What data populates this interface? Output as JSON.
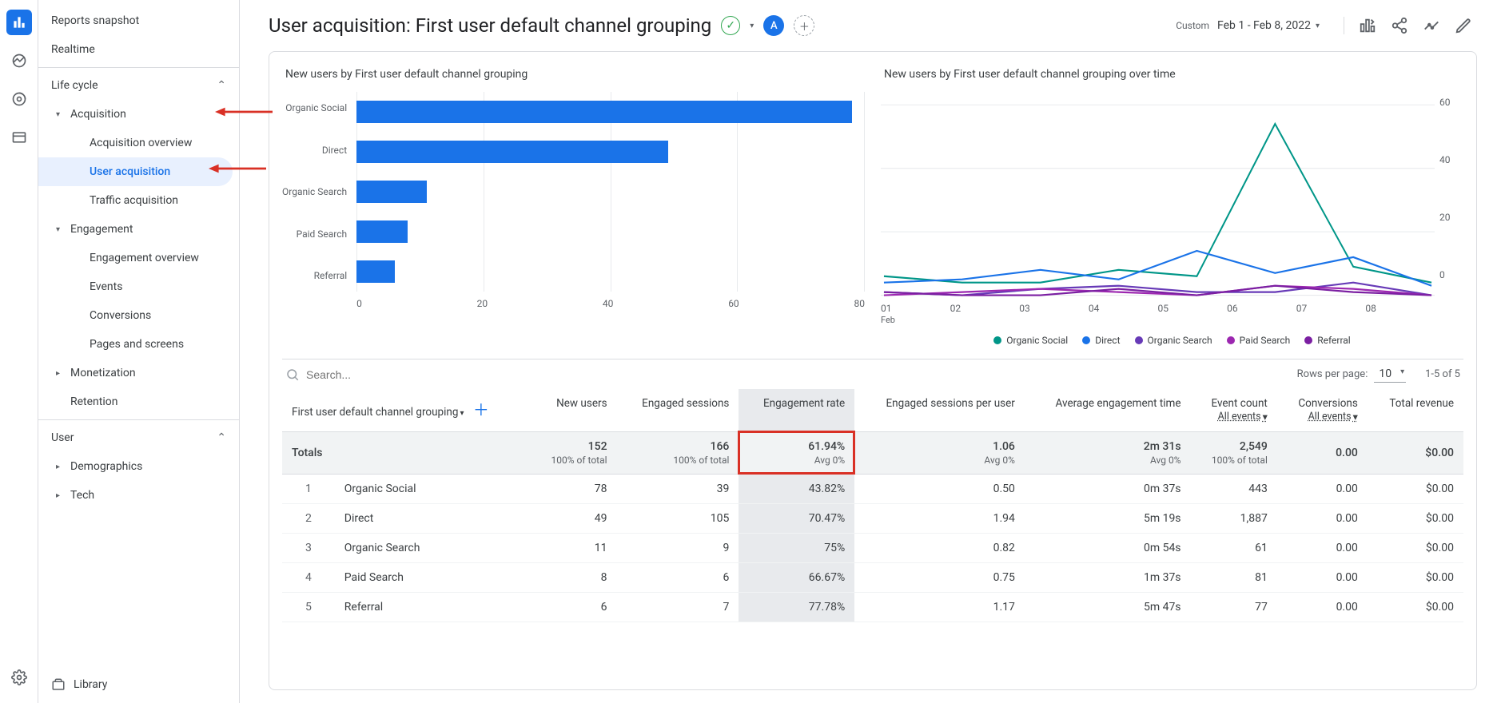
{
  "iconbar": {
    "items": [
      "reports",
      "realtime",
      "explore",
      "advertising"
    ],
    "bottom": "settings"
  },
  "sidebar": {
    "top": [
      "Reports snapshot",
      "Realtime"
    ],
    "lifecycle_label": "Life cycle",
    "acquisition": {
      "label": "Acquisition",
      "items": [
        "Acquisition overview",
        "User acquisition",
        "Traffic acquisition"
      ],
      "active_index": 1
    },
    "engagement": {
      "label": "Engagement",
      "items": [
        "Engagement overview",
        "Events",
        "Conversions",
        "Pages and screens"
      ]
    },
    "monetization": {
      "label": "Monetization"
    },
    "retention": {
      "label": "Retention"
    },
    "user_label": "User",
    "demographics": {
      "label": "Demographics"
    },
    "tech": {
      "label": "Tech"
    },
    "library": "Library"
  },
  "header": {
    "title": "User acquisition: First user default channel grouping",
    "avatar": "A",
    "custom_label": "Custom",
    "daterange": "Feb 1 - Feb 8, 2022"
  },
  "chart_data": [
    {
      "type": "bar",
      "title": "New users by First user default channel grouping",
      "categories": [
        "Organic Social",
        "Direct",
        "Organic Search",
        "Paid Search",
        "Referral"
      ],
      "values": [
        78,
        49,
        11,
        8,
        6
      ],
      "xlabel": "",
      "ylabel": "",
      "xlim": [
        0,
        80
      ],
      "xticks": [
        0,
        20,
        40,
        60,
        80
      ]
    },
    {
      "type": "line",
      "title": "New users by First user default channel grouping over time",
      "x": [
        "01",
        "02",
        "03",
        "04",
        "05",
        "06",
        "07",
        "08"
      ],
      "x_sublabel": "Feb",
      "ylim": [
        0,
        60
      ],
      "yticks": [
        0,
        20,
        40,
        60
      ],
      "series": [
        {
          "name": "Organic Social",
          "color": "#009688",
          "values": [
            6,
            4,
            4,
            8,
            6,
            54,
            9,
            4
          ]
        },
        {
          "name": "Direct",
          "color": "#1a73e8",
          "values": [
            4,
            5,
            8,
            5,
            14,
            7,
            12,
            3
          ]
        },
        {
          "name": "Organic Search",
          "color": "#673ab7",
          "values": [
            1,
            0,
            2,
            3,
            1,
            1,
            4,
            0
          ]
        },
        {
          "name": "Paid Search",
          "color": "#9c27b0",
          "values": [
            0,
            1,
            2,
            1,
            0,
            3,
            2,
            0
          ]
        },
        {
          "name": "Referral",
          "color": "#7b1fa2",
          "values": [
            1,
            0,
            0,
            2,
            0,
            3,
            1,
            0
          ]
        }
      ]
    }
  ],
  "table": {
    "search_placeholder": "Search...",
    "rows_per_page_label": "Rows per page:",
    "rows_per_page_value": "10",
    "pager": "1-5 of 5",
    "columns": {
      "c0": "First user default channel grouping",
      "c1": "New users",
      "c2": "Engaged sessions",
      "c3": "Engagement rate",
      "c4": "Engaged sessions per user",
      "c5": "Average engagement time",
      "c6": "Event count",
      "c6_sub": "All events",
      "c7": "Conversions",
      "c7_sub": "All events",
      "c8": "Total revenue"
    },
    "totals": {
      "label": "Totals",
      "new_users": "152",
      "new_users_sub": "100% of total",
      "engaged_sessions": "166",
      "engaged_sessions_sub": "100% of total",
      "engagement_rate": "61.94%",
      "engagement_rate_sub": "Avg 0%",
      "sessions_per_user": "1.06",
      "sessions_per_user_sub": "Avg 0%",
      "avg_time": "2m 31s",
      "avg_time_sub": "Avg 0%",
      "event_count": "2,549",
      "event_count_sub": "100% of total",
      "conversions": "0.00",
      "revenue": "$0.00"
    },
    "rows": [
      {
        "idx": "1",
        "name": "Organic Social",
        "new_users": "78",
        "engaged": "39",
        "rate": "43.82%",
        "spu": "0.50",
        "time": "0m 37s",
        "events": "443",
        "conv": "0.00",
        "rev": "$0.00"
      },
      {
        "idx": "2",
        "name": "Direct",
        "new_users": "49",
        "engaged": "105",
        "rate": "70.47%",
        "spu": "1.94",
        "time": "5m 19s",
        "events": "1,887",
        "conv": "0.00",
        "rev": "$0.00"
      },
      {
        "idx": "3",
        "name": "Organic Search",
        "new_users": "11",
        "engaged": "9",
        "rate": "75%",
        "spu": "0.82",
        "time": "0m 54s",
        "events": "61",
        "conv": "0.00",
        "rev": "$0.00"
      },
      {
        "idx": "4",
        "name": "Paid Search",
        "new_users": "8",
        "engaged": "6",
        "rate": "66.67%",
        "spu": "0.75",
        "time": "1m 37s",
        "events": "81",
        "conv": "0.00",
        "rev": "$0.00"
      },
      {
        "idx": "5",
        "name": "Referral",
        "new_users": "6",
        "engaged": "7",
        "rate": "77.78%",
        "spu": "1.17",
        "time": "5m 47s",
        "events": "77",
        "conv": "0.00",
        "rev": "$0.00"
      }
    ]
  }
}
